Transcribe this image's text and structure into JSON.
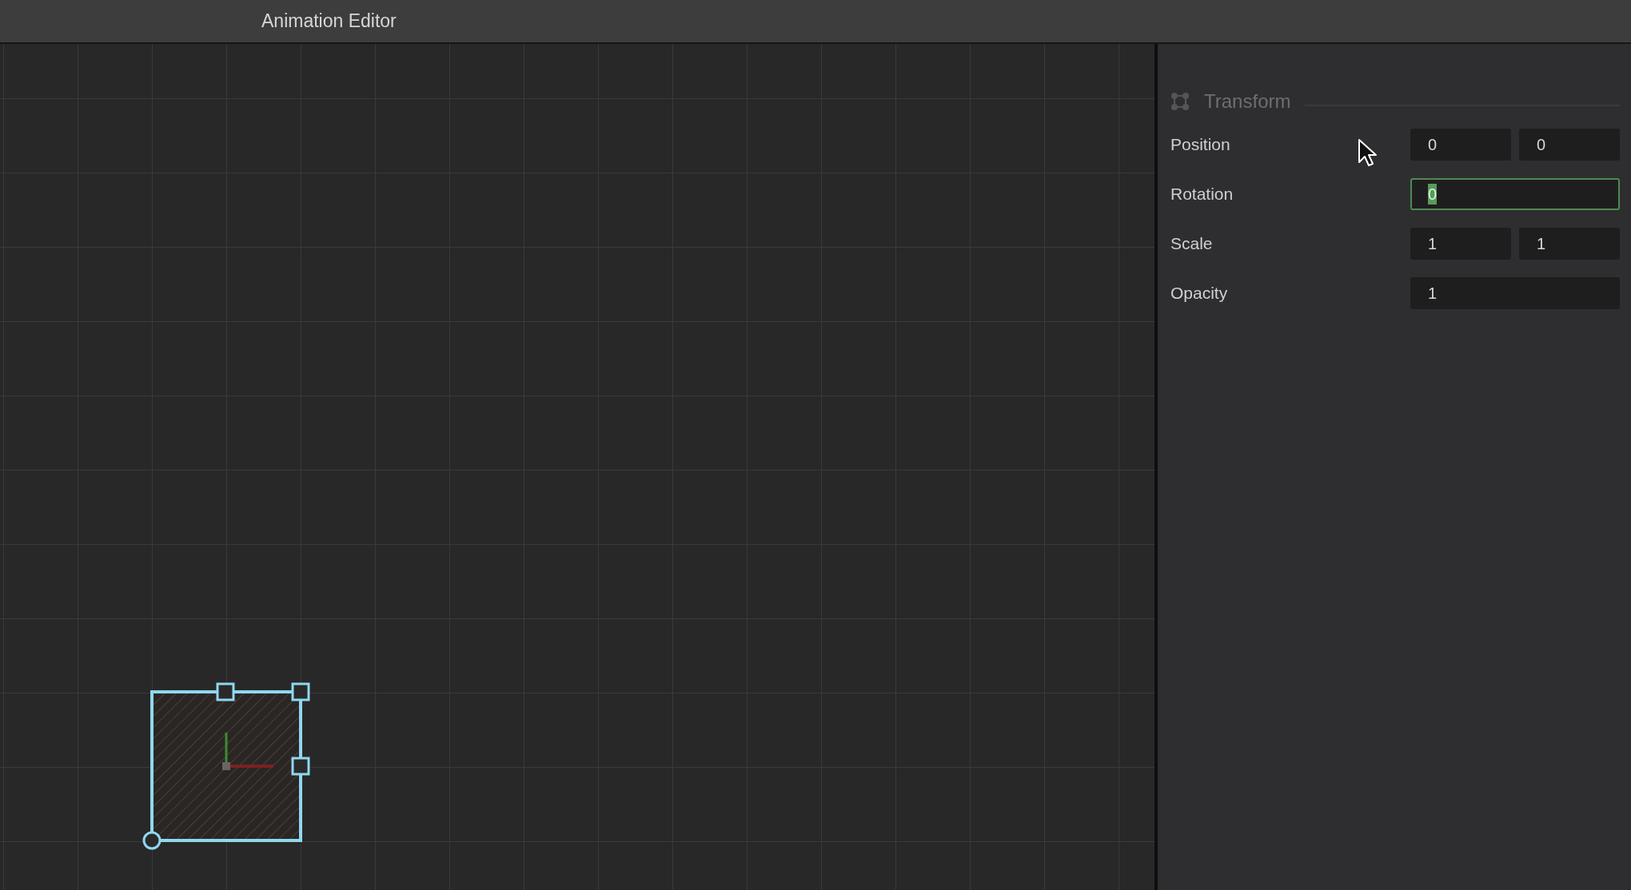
{
  "window": {
    "title": "Animation Editor"
  },
  "inspector": {
    "section": {
      "title": "Transform"
    },
    "properties": [
      {
        "label": "Position",
        "fields": [
          {
            "value": "0",
            "focused": false
          },
          {
            "value": "0",
            "focused": false
          }
        ]
      },
      {
        "label": "Rotation",
        "fields": [
          {
            "value": "0",
            "focused": true
          }
        ]
      },
      {
        "label": "Scale",
        "fields": [
          {
            "value": "1",
            "focused": false
          },
          {
            "value": "1",
            "focused": false
          }
        ]
      },
      {
        "label": "Opacity",
        "fields": [
          {
            "value": "1",
            "focused": false
          }
        ]
      }
    ]
  }
}
